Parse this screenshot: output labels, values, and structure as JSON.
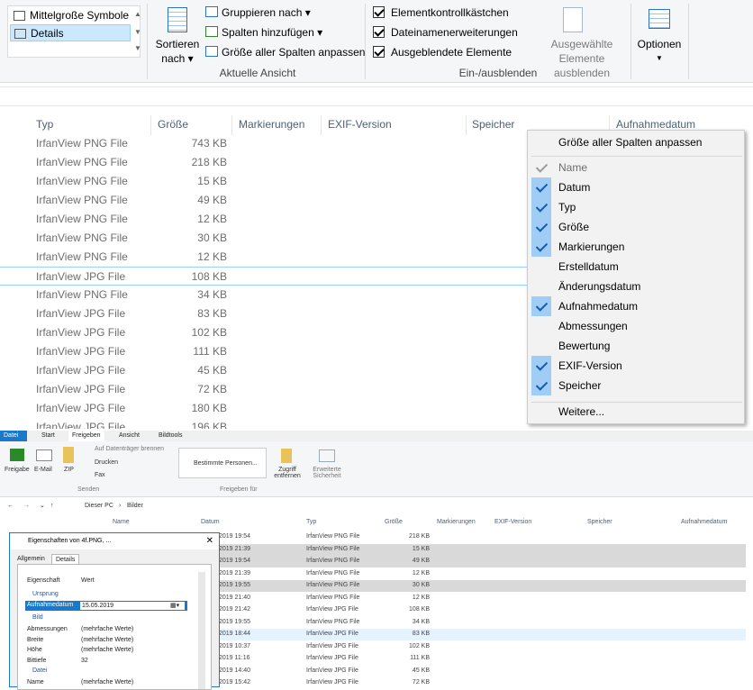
{
  "ribbon": {
    "layout_items": [
      "Mittelgroße Symbole",
      "Details"
    ],
    "sort_label": "Sortieren nach",
    "group_by": "Gruppieren nach",
    "add_columns": "Spalten hinzufügen",
    "fit_columns": "Größe aller Spalten anpassen",
    "current_view": "Aktuelle Ansicht",
    "checkboxes": [
      "Elementkontrollkästchen",
      "Dateinamenerweiterungen",
      "Ausgeblendete Elemente"
    ],
    "hide_selected_1": "Ausgewählte",
    "hide_selected_2": "Elemente ausblenden",
    "show_hide": "Ein-/ausblenden",
    "options": "Optionen"
  },
  "columns": [
    "Typ",
    "Größe",
    "Markierungen",
    "EXIF-Version",
    "Speicher",
    "Aufnahmedatum"
  ],
  "rows": [
    {
      "type": "IrfanView PNG File",
      "size": "743 KB"
    },
    {
      "type": "IrfanView PNG File",
      "size": "218 KB"
    },
    {
      "type": "IrfanView PNG File",
      "size": "15 KB"
    },
    {
      "type": "IrfanView PNG File",
      "size": "49 KB"
    },
    {
      "type": "IrfanView PNG File",
      "size": "12 KB"
    },
    {
      "type": "IrfanView PNG File",
      "size": "30 KB"
    },
    {
      "type": "IrfanView PNG File",
      "size": "12 KB"
    },
    {
      "type": "IrfanView JPG File",
      "size": "108 KB"
    },
    {
      "type": "IrfanView PNG File",
      "size": "34 KB"
    },
    {
      "type": "IrfanView JPG File",
      "size": "83 KB"
    },
    {
      "type": "IrfanView JPG File",
      "size": "102 KB"
    },
    {
      "type": "IrfanView JPG File",
      "size": "111 KB"
    },
    {
      "type": "IrfanView JPG File",
      "size": "45 KB"
    },
    {
      "type": "IrfanView JPG File",
      "size": "72 KB"
    },
    {
      "type": "IrfanView JPG File",
      "size": "180 KB"
    },
    {
      "type": "IrfanView JPG File",
      "size": "196 KB"
    }
  ],
  "context_menu": {
    "fit_all": "Größe aller Spalten anpassen",
    "items": [
      {
        "label": "Name",
        "checked": true,
        "disabled": true
      },
      {
        "label": "Datum",
        "checked": true,
        "disabled": false
      },
      {
        "label": "Typ",
        "checked": true,
        "disabled": false
      },
      {
        "label": "Größe",
        "checked": true,
        "disabled": false
      },
      {
        "label": "Markierungen",
        "checked": true,
        "disabled": false
      },
      {
        "label": "Erstelldatum",
        "checked": false,
        "disabled": false
      },
      {
        "label": "Änderungsdatum",
        "checked": false,
        "disabled": false
      },
      {
        "label": "Aufnahmedatum",
        "checked": true,
        "disabled": false
      },
      {
        "label": "Abmessungen",
        "checked": false,
        "disabled": false
      },
      {
        "label": "Bewertung",
        "checked": false,
        "disabled": false
      },
      {
        "label": "EXIF-Version",
        "checked": true,
        "disabled": false
      },
      {
        "label": "Speicher",
        "checked": true,
        "disabled": false
      }
    ],
    "more": "Weitere..."
  },
  "lower": {
    "tabs": [
      "Datei",
      "Start",
      "Freigeben",
      "Ansicht",
      "Bildtools"
    ],
    "share_buttons": [
      "Freigabe",
      "E-Mail",
      "ZIP"
    ],
    "burn": "Auf Datenträger brennen",
    "print": "Drucken",
    "fax": "Fax",
    "send_group": "Senden",
    "people": "Bestimmte Personen...",
    "stop_share_1": "Zugriff",
    "stop_share_2": "entfernen",
    "adv_1": "Erweiterte",
    "adv_2": "Sicherheit",
    "share_group": "Freigeben für",
    "path": [
      "Dieser PC",
      "Bilder"
    ],
    "headers": [
      "Name",
      "Datum",
      "Typ",
      "Größe",
      "Markierungen",
      "EXIF-Version",
      "Speicher",
      "Aufnahmedatum"
    ],
    "rows": [
      {
        "date": "2019 19:54",
        "type": "IrfanView PNG File",
        "size": "218 KB",
        "style": ""
      },
      {
        "date": "2019 21:39",
        "type": "IrfanView PNG File",
        "size": "15 KB",
        "style": "g"
      },
      {
        "date": "2019 19:54",
        "type": "IrfanView PNG File",
        "size": "49 KB",
        "style": "g"
      },
      {
        "date": "2019 21:39",
        "type": "IrfanView PNG File",
        "size": "12 KB",
        "style": ""
      },
      {
        "date": "2019 19:55",
        "type": "IrfanView PNG File",
        "size": "30 KB",
        "style": "g"
      },
      {
        "date": "2019 21:40",
        "type": "IrfanView PNG File",
        "size": "12 KB",
        "style": ""
      },
      {
        "date": "2019 21:42",
        "type": "IrfanView JPG File",
        "size": "108 KB",
        "style": ""
      },
      {
        "date": "2019 19:55",
        "type": "IrfanView PNG File",
        "size": "34 KB",
        "style": ""
      },
      {
        "date": "2019 18:44",
        "type": "IrfanView JPG File",
        "size": "83 KB",
        "style": "b"
      },
      {
        "date": "2019 10:37",
        "type": "IrfanView JPG File",
        "size": "102 KB",
        "style": ""
      },
      {
        "date": "2019 11:16",
        "type": "IrfanView JPG File",
        "size": "111 KB",
        "style": ""
      },
      {
        "date": "2019 14:40",
        "type": "IrfanView JPG File",
        "size": "45 KB",
        "style": ""
      },
      {
        "date": "2019 15:42",
        "type": "IrfanView JPG File",
        "size": "72 KB",
        "style": ""
      }
    ],
    "dialog": {
      "title": "Eigenschaften von 4f.PNG, ...",
      "tabs": [
        "Allgemein",
        "Details"
      ],
      "col_prop": "Eigenschaft",
      "col_val": "Wert",
      "sec_origin": "Ursprung",
      "rec_label": "Aufnahmedatum",
      "rec_value": "15.05.2019",
      "sec_image": "Bild",
      "props": [
        {
          "k": "Abmessungen",
          "v": "(mehrfache Werte)"
        },
        {
          "k": "Breite",
          "v": "(mehrfache Werte)"
        },
        {
          "k": "Höhe",
          "v": "(mehrfache Werte)"
        },
        {
          "k": "Bittiefe",
          "v": "32"
        }
      ],
      "sec_file": "Datei",
      "name_k": "Name",
      "name_v": "(mehrfache Werte)"
    }
  }
}
